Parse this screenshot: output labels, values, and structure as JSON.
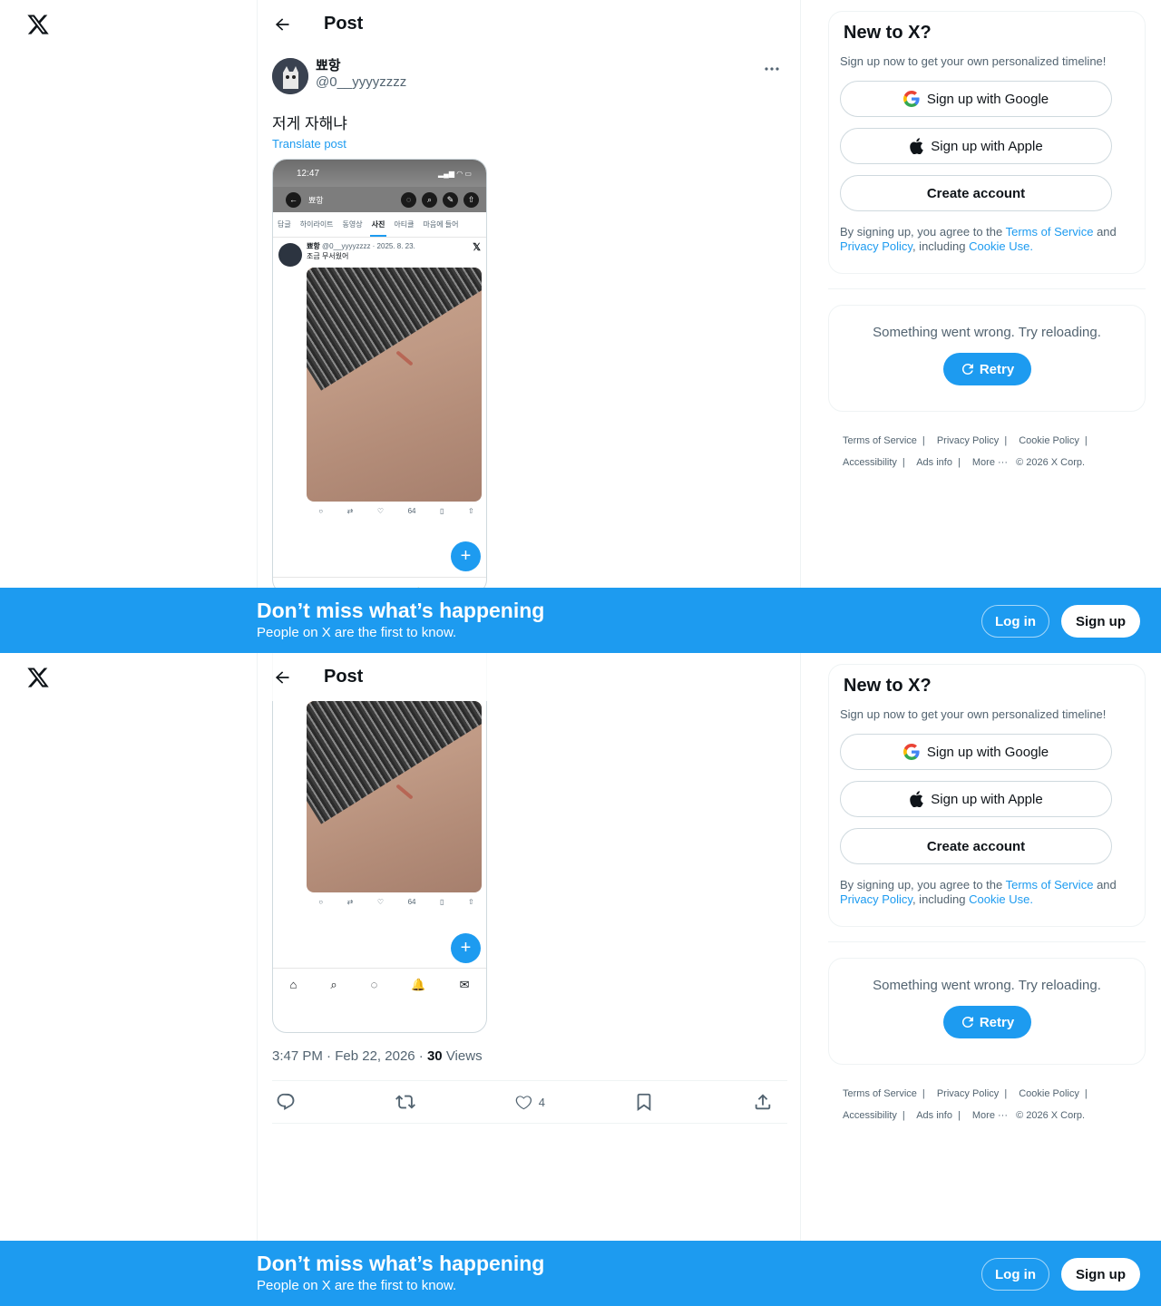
{
  "header": {
    "title": "Post"
  },
  "post": {
    "display_name": "뾰항",
    "handle": "@0__yyyyzzzz",
    "text": "저게 자해냐",
    "translate_label": "Translate post",
    "time": "3:47 PM",
    "date": "Feb 22, 2026",
    "views_count": "30",
    "views_label": "Views",
    "like_count": "4"
  },
  "screenshot": {
    "clock": "12:47",
    "profile_name": "뾰항",
    "tabs": [
      "답글",
      "하이라이트",
      "동영상",
      "사진",
      "아티클",
      "마음에 들어"
    ],
    "active_tab": "사진",
    "inner_name": "뾰항",
    "inner_meta": "@0__yyyyzzzz · 2025. 8. 23.",
    "inner_text": "조금 무서웠어",
    "inner_views": "64"
  },
  "sidebar": {
    "signup_title": "New to X?",
    "signup_sub": "Sign up now to get your own personalized timeline!",
    "google_label": "Sign up with Google",
    "apple_label": "Sign up with Apple",
    "create_label": "Create account",
    "legal_prefix": "By signing up, you agree to the",
    "terms_link": "Terms of Service",
    "and": "and",
    "privacy_link": "Privacy Policy",
    "including": ", including",
    "cookie_link": "Cookie Use.",
    "error_text": "Something went wrong. Try reloading.",
    "retry_label": "Retry"
  },
  "footer": {
    "terms": "Terms of Service",
    "privacy": "Privacy Policy",
    "cookie": "Cookie Policy",
    "accessibility": "Accessibility",
    "ads": "Ads info",
    "more": "More ···",
    "copyright": "© 2026 X Corp."
  },
  "banner": {
    "title": "Don’t miss what’s happening",
    "subtitle": "People on X are the first to know.",
    "login_label": "Log in",
    "signup_label": "Sign up"
  },
  "colors": {
    "accent": "#1d9bf0",
    "text": "#0f1419",
    "muted": "#536471",
    "border": "#eff3f4"
  }
}
